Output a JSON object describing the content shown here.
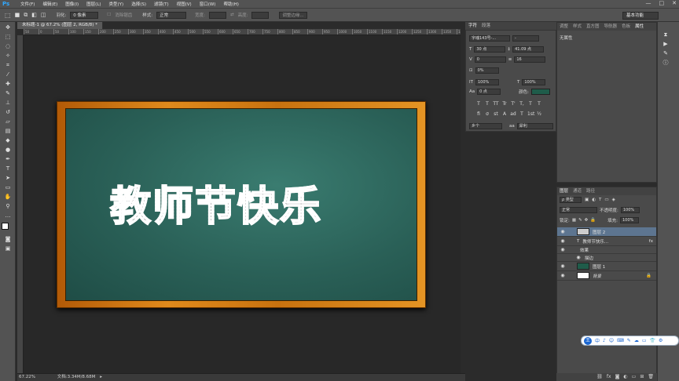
{
  "menubar": {
    "logo": "Ps",
    "items": [
      "文件(F)",
      "编辑(E)",
      "图像(I)",
      "图层(L)",
      "类型(Y)",
      "选择(S)",
      "滤镜(T)",
      "视图(V)",
      "窗口(W)",
      "帮助(H)"
    ],
    "window_controls": [
      "—",
      "□",
      "✕"
    ]
  },
  "options": {
    "feather_label": "羽化:",
    "feather_value": "0 像素",
    "antialias_label": "消除锯齿",
    "style_label": "样式:",
    "style_value": "正常",
    "width_label": "宽度:",
    "height_label": "高度:",
    "refine_label": "调整边缘...",
    "workspace": "基本功能"
  },
  "document": {
    "tab_title": "未标题-1 @ 67.2% (图层 2, RGB/8) *",
    "ruler_ticks": [
      "50",
      "0",
      "50",
      "100",
      "150",
      "200",
      "250",
      "300",
      "350",
      "400",
      "450",
      "500",
      "550",
      "600",
      "650",
      "700",
      "750",
      "800",
      "850",
      "900",
      "950",
      "1000",
      "1050",
      "1100",
      "1150",
      "1200",
      "1250",
      "1300",
      "1350",
      "1400"
    ],
    "canvas_text": "教师节快乐"
  },
  "status": {
    "zoom": "67.22%",
    "doc_size": "文档:3.34M/8.68M"
  },
  "character_panel": {
    "tabs": [
      "字符",
      "段落"
    ],
    "font_family": "字魂143号-...",
    "font_style": "-",
    "font_size": "30 点",
    "leading": "41.09 点",
    "kerning": "0",
    "tracking": "16",
    "scale_percent": "0%",
    "vertical_scale": "100%",
    "horizontal_scale": "100%",
    "baseline": "0 点",
    "color_label": "颜色:",
    "style_buttons": [
      "T",
      "T",
      "TT",
      "Tr",
      "T'",
      "T,",
      "T",
      "T"
    ],
    "ot_buttons": [
      "fi",
      "σ",
      "st",
      "A",
      "ad",
      "T",
      "1st",
      "½"
    ],
    "language": "美国英语",
    "language_short": "乡个",
    "antialias": "犀利",
    "antialias_prefix": "aa"
  },
  "properties_panel": {
    "tabs": [
      "调整",
      "样式",
      "直方图",
      "导航器",
      "色板",
      "属性"
    ],
    "content": "无属性"
  },
  "layers_panel": {
    "tabs": [
      "图层",
      "通道",
      "路径"
    ],
    "filter": "ρ 类型",
    "blend_mode": "正常",
    "opacity_label": "不透明度:",
    "opacity_value": "100%",
    "lock_label": "锁定:",
    "fill_label": "填充:",
    "fill_value": "100%",
    "layers": [
      {
        "name": "图层 2",
        "type": "pixel"
      },
      {
        "name": "教师节快乐...",
        "type": "text",
        "fx": "fx"
      },
      {
        "name": "效果",
        "type": "effect"
      },
      {
        "name": "描边",
        "type": "effect-item"
      },
      {
        "name": "图层 1",
        "type": "pixel"
      },
      {
        "name": "背景",
        "type": "background"
      }
    ]
  },
  "ime": {
    "label": "中",
    "items": [
      "中",
      "♪",
      "☺",
      "⌨",
      "✎",
      "☁",
      "▭",
      "👕",
      "⚙"
    ]
  },
  "colors": {
    "board_green": "#2a6057",
    "frame_orange": "#d9801a",
    "panel_gray": "#4a4a4a",
    "selected_layer": "#5d7590"
  }
}
